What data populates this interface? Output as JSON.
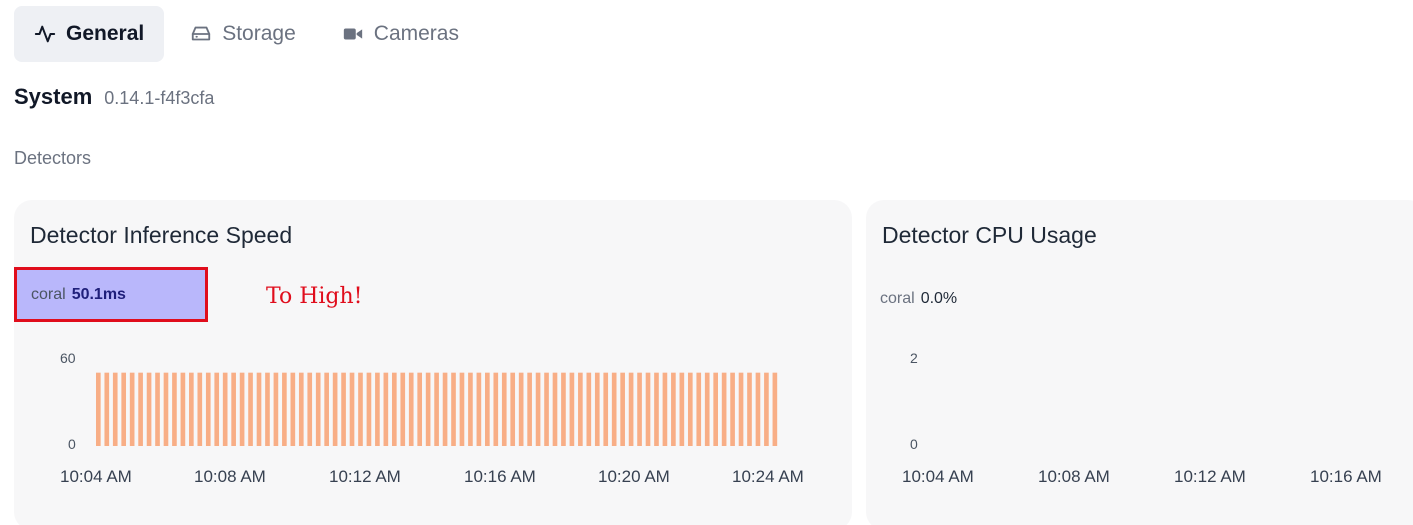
{
  "tabs": [
    {
      "label": "General",
      "icon": "activity-icon",
      "active": true
    },
    {
      "label": "Storage",
      "icon": "hard-drive-icon",
      "active": false
    },
    {
      "label": "Cameras",
      "icon": "video-icon",
      "active": false
    }
  ],
  "system": {
    "title": "System",
    "version": "0.14.1-f4f3cfa"
  },
  "section_label": "Detectors",
  "colors": {
    "bar": "#f8ae86",
    "highlight_bg": "#b9b7fb",
    "highlight_border": "#e00d1c",
    "annotation": "#e00d1c"
  },
  "inference_card": {
    "title": "Detector Inference Speed",
    "stat_label": "coral",
    "stat_value": "50.1ms",
    "annotation": "To High!"
  },
  "cpu_card": {
    "title": "Detector CPU Usage",
    "stat_label": "coral",
    "stat_value": "0.0%"
  },
  "chart_data": [
    {
      "type": "bar",
      "title": "Detector Inference Speed",
      "series": [
        {
          "name": "coral",
          "values": [
            50,
            50,
            50,
            50,
            50,
            50,
            50,
            50,
            50,
            50,
            50,
            50,
            50,
            50,
            50,
            50,
            50,
            50,
            50,
            50,
            50,
            50,
            50,
            50,
            50,
            50,
            50,
            50,
            50,
            50,
            50,
            50,
            50,
            50,
            50,
            50,
            50,
            50,
            50,
            50,
            50,
            50,
            50,
            50,
            50,
            50,
            50,
            50,
            50,
            50,
            50,
            50,
            50,
            50,
            50,
            50,
            50,
            50,
            50,
            50,
            50,
            50,
            50,
            50,
            50,
            50,
            50,
            50,
            50,
            50,
            50,
            50,
            50,
            50,
            50,
            50,
            50,
            50,
            50,
            50,
            50
          ]
        }
      ],
      "x_ticks": [
        "10:04 AM",
        "10:08 AM",
        "10:12 AM",
        "10:16 AM",
        "10:20 AM",
        "10:24 AM"
      ],
      "y_ticks": [
        "60",
        "0"
      ],
      "ylim": [
        0,
        60
      ]
    },
    {
      "type": "bar",
      "title": "Detector CPU Usage",
      "series": [
        {
          "name": "coral",
          "values": []
        }
      ],
      "x_ticks": [
        "10:04 AM",
        "10:08 AM",
        "10:12 AM",
        "10:16 AM"
      ],
      "y_ticks": [
        "2",
        "0"
      ],
      "ylim": [
        0,
        2
      ]
    }
  ]
}
